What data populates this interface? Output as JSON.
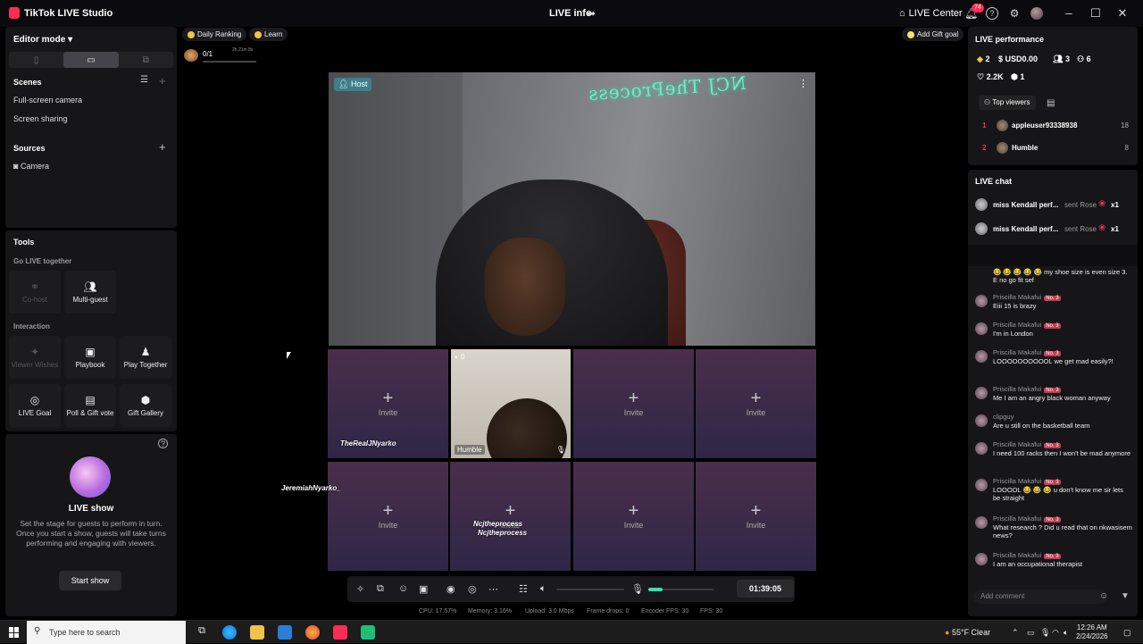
{
  "titlebar": {
    "app_title": "TikTok LIVE Studio",
    "center_title": "LIVE info",
    "live_center": "LIVE Center",
    "notif_count": "74"
  },
  "left": {
    "editor_mode": "Editor mode",
    "scenes_title": "Scenes",
    "scenes": [
      "Full-screen camera",
      "Screen sharing"
    ],
    "sources_title": "Sources",
    "sources": [
      "Camera"
    ],
    "tools_title": "Tools",
    "go_live_together": "Go LIVE together",
    "cohost": "Co-host",
    "multiguest": "Multi-guest",
    "interaction": "Interaction",
    "viewer_wishes": "Viewer Wishes",
    "playbook": "Playbook",
    "play_together": "Play Together",
    "live_goal": "LIVE Goal",
    "poll_gift_vote": "Poll & Gift vote",
    "gift_gallery": "Gift Gallery",
    "live_show_title": "LIVE show",
    "live_show_desc": "Set the stage for guests to perform in turn. Once you start a show, guests will take turns performing and engaging with viewers.",
    "start_show": "Start show"
  },
  "top": {
    "daily_ranking": "Daily Ranking",
    "learn": "Learn",
    "ranking_value": "0/1",
    "ranking_time": "2h 21m 8s",
    "add_gift_goal": "Add Gift goal"
  },
  "stage": {
    "host_tag": "Host",
    "neon_text": "NCJ TheProcess",
    "invite": "Invite",
    "guest_name": "Humble",
    "guest_count": "0",
    "overlay1": "TheRealJNyarko",
    "overlay2": "JeremiahNyarko_",
    "overlay3": "Ncjtheprocess",
    "overlay4": "Ncjtheprocess",
    "timer": "01:39:05",
    "mic_level": 0.22
  },
  "stats": {
    "cpu": "CPU: 17.57%",
    "memory": "Memory: 3.16%",
    "upload": "Upload: 3.0 Mbps",
    "drops": "Frame drops: 0",
    "encoder": "Encoder FPS: 30",
    "fps": "FPS: 30"
  },
  "right": {
    "perf_title": "LIVE performance",
    "diamonds": "2",
    "usd": "USD0.00",
    "viewers": "3",
    "new_followers": "6",
    "likes": "2.2K",
    "gifts": "1",
    "top_viewers": "Top viewers",
    "tv": [
      {
        "rank": "1",
        "name": "appleuser93338938",
        "score": "18"
      },
      {
        "rank": "2",
        "name": "Humble",
        "score": "8"
      }
    ],
    "chat_title": "LIVE chat",
    "gifts_list": [
      {
        "name": "miss Kendall perf...",
        "sent": "sent Rose",
        "x": "x1"
      },
      {
        "name": "miss Kendall perf...",
        "sent": "sent Rose",
        "x": "x1"
      }
    ],
    "chat": [
      {
        "user": "",
        "badge": "",
        "msg": "😂 😂 😂 😂 😂 my shoe size is even size 3. E no go fit sef"
      },
      {
        "user": "Priscilla Makafui",
        "badge": "No. 3",
        "msg": "Eiii 15 is brazy"
      },
      {
        "user": "Priscilla Makafui",
        "badge": "No. 3",
        "msg": "I'm in London"
      },
      {
        "user": "Priscilla Makafui",
        "badge": "No. 3",
        "msg": "LOOOOOOOOOOL we get mad easily?!"
      },
      {
        "user": "Priscilla Makafui",
        "badge": "No. 3",
        "msg": "Me I am an angry black woman anyway"
      },
      {
        "user": "clipguy",
        "badge": "",
        "msg": "Are u still on the basketball team"
      },
      {
        "user": "Priscilla Makafui",
        "badge": "No. 3",
        "msg": "I need 100 racks then I won't be mad anymore"
      },
      {
        "user": "Priscilla Makafui",
        "badge": "No. 3",
        "msg": "LOOOOL 😂 😂 😂 u don't know me sir lets be straight"
      },
      {
        "user": "Priscilla Makafui",
        "badge": "No. 3",
        "msg": "What research ? Did u read that on nkwasisem news?"
      },
      {
        "user": "Priscilla Makafui",
        "badge": "No. 3",
        "msg": "I am an occupational therapist"
      }
    ],
    "comment_placeholder": "Add comment"
  },
  "taskbar": {
    "search_placeholder": "Type here to search",
    "weather": "55°F  Clear",
    "time": "12:26 AM",
    "date": "2/24/2026"
  },
  "colors": {
    "accent": "#fe2c55",
    "mic_green": "#2ee6a8",
    "slot_purple": "#3d2a48"
  }
}
